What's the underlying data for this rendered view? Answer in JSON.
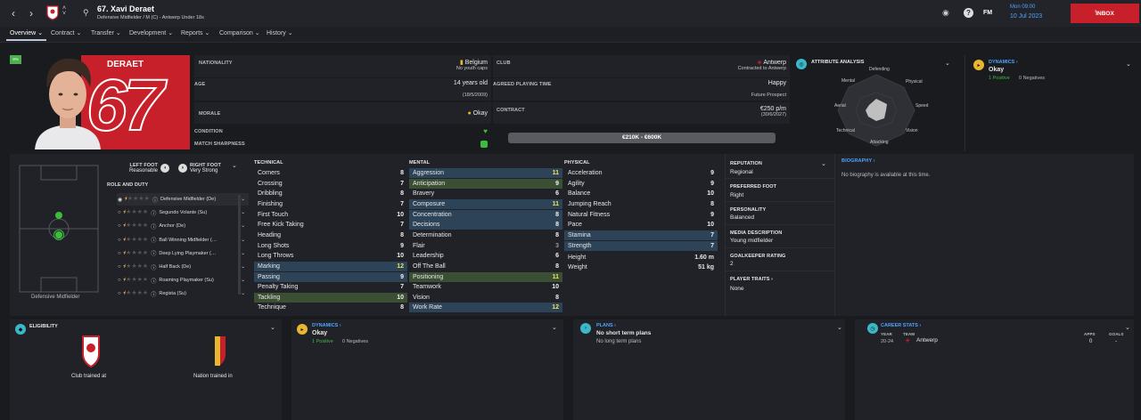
{
  "header": {
    "title": "67. Xavi Deraet",
    "subtitle": "Defensive Midfielder / M (C) - Antwerp Under 18s",
    "date_day": "Mon 09:00",
    "date": "10 Jul 2023",
    "fm_label": "FM",
    "inbox_label": "INBOX"
  },
  "tabs": [
    {
      "label": "Overview"
    },
    {
      "label": "Contract"
    },
    {
      "label": "Transfer"
    },
    {
      "label": "Development"
    },
    {
      "label": "Reports"
    },
    {
      "label": "Comparison"
    },
    {
      "label": "History"
    }
  ],
  "profile": {
    "badge": "9%",
    "surname": "DERAET",
    "number": "67"
  },
  "info": {
    "nationality_label": "NATIONALITY",
    "nationality": "Belgium",
    "youth_caps": "No youth caps",
    "age_label": "AGE",
    "age": "14 years old",
    "dob": "(18/5/2009)",
    "morale_label": "MORALE",
    "morale": "Okay",
    "condition_label": "CONDITION",
    "sharpness_label": "MATCH SHARPNESS",
    "club_label": "CLUB",
    "club": "Antwerp",
    "contracted": "Contracted to Antwerp",
    "playing_time_label": "AGREED PLAYING TIME",
    "playing_time": "Happy",
    "playing_time_sub": "Future Prospect",
    "contract_label": "CONTRACT",
    "wage": "€250 p/m",
    "contract_end": "(30/6/2027)",
    "value": "€210K - €600K"
  },
  "attribute_analysis": {
    "title": "ATTRIBUTE ANALYSIS",
    "axes": [
      "Defending",
      "Physical",
      "Speed",
      "Vision",
      "Attacking",
      "Technical",
      "Aerial",
      "Mental"
    ]
  },
  "dynamics_top": {
    "title": "DYNAMICS",
    "status": "Okay",
    "positives": "1 Positive",
    "negatives": "0 Negatives"
  },
  "feet": {
    "left_label": "LEFT FOOT",
    "left": "Reasonable",
    "right_label": "RIGHT FOOT",
    "right": "Very Strong"
  },
  "pitch_label": "Defensive Midfielder",
  "roles_title": "ROLE AND DUTY",
  "roles": [
    {
      "name": "Defensive Midfielder (De)",
      "stars": 0.5
    },
    {
      "name": "Segundo Volante (Su)",
      "stars": 0.5
    },
    {
      "name": "Anchor (De)",
      "stars": 0.5
    },
    {
      "name": "Ball Winning Midfielder (…",
      "stars": 0.5
    },
    {
      "name": "Deep Lying Playmaker (…",
      "stars": 0.5
    },
    {
      "name": "Half Back (De)",
      "stars": 0.5
    },
    {
      "name": "Roaming Playmaker (Su)",
      "stars": 0.5
    },
    {
      "name": "Regista (Su)",
      "stars": 0.5
    }
  ],
  "technical": {
    "title": "TECHNICAL",
    "rows": [
      {
        "name": "Corners",
        "value": "8"
      },
      {
        "name": "Crossing",
        "value": "7"
      },
      {
        "name": "Dribbling",
        "value": "8"
      },
      {
        "name": "Finishing",
        "value": "7"
      },
      {
        "name": "First Touch",
        "value": "10"
      },
      {
        "name": "Free Kick Taking",
        "value": "7"
      },
      {
        "name": "Heading",
        "value": "8"
      },
      {
        "name": "Long Shots",
        "value": "9"
      },
      {
        "name": "Long Throws",
        "value": "10"
      },
      {
        "name": "Marking",
        "value": "12"
      },
      {
        "name": "Passing",
        "value": "9"
      },
      {
        "name": "Penalty Taking",
        "value": "7"
      },
      {
        "name": "Tackling",
        "value": "10"
      },
      {
        "name": "Technique",
        "value": "8"
      }
    ]
  },
  "mental": {
    "title": "MENTAL",
    "rows": [
      {
        "name": "Aggression",
        "value": "11"
      },
      {
        "name": "Anticipation",
        "value": "9"
      },
      {
        "name": "Bravery",
        "value": "6"
      },
      {
        "name": "Composure",
        "value": "11"
      },
      {
        "name": "Concentration",
        "value": "8"
      },
      {
        "name": "Decisions",
        "value": "8"
      },
      {
        "name": "Determination",
        "value": "8"
      },
      {
        "name": "Flair",
        "value": "3"
      },
      {
        "name": "Leadership",
        "value": "6"
      },
      {
        "name": "Off The Ball",
        "value": "8"
      },
      {
        "name": "Positioning",
        "value": "11"
      },
      {
        "name": "Teamwork",
        "value": "10"
      },
      {
        "name": "Vision",
        "value": "8"
      },
      {
        "name": "Work Rate",
        "value": "12"
      }
    ]
  },
  "physical": {
    "title": "PHYSICAL",
    "rows": [
      {
        "name": "Acceleration",
        "value": "9"
      },
      {
        "name": "Agility",
        "value": "9"
      },
      {
        "name": "Balance",
        "value": "10"
      },
      {
        "name": "Jumping Reach",
        "value": "8"
      },
      {
        "name": "Natural Fitness",
        "value": "9"
      },
      {
        "name": "Pace",
        "value": "10"
      },
      {
        "name": "Stamina",
        "value": "7"
      },
      {
        "name": "Strength",
        "value": "7"
      }
    ],
    "height_label": "Height",
    "height": "1.60 m",
    "weight_label": "Weight",
    "weight": "51 kg"
  },
  "side_info": {
    "reputation_label": "REPUTATION",
    "reputation": "Regional",
    "preferred_foot_label": "PREFERRED FOOT",
    "preferred_foot": "Right",
    "personality_label": "PERSONALITY",
    "personality": "Balanced",
    "media_label": "MEDIA DESCRIPTION",
    "media": "Young midfielder",
    "gk_label": "GOALKEEPER RATING",
    "gk": "2",
    "traits_label": "PLAYER TRAITS",
    "traits": "None"
  },
  "biography": {
    "title": "BIOGRAPHY",
    "text": "No biography is available at this time."
  },
  "eligibility": {
    "title": "ELIGIBILITY",
    "club_label": "Club trained at",
    "nation_label": "Nation trained in"
  },
  "dynamics_bottom": {
    "title": "DYNAMICS",
    "status": "Okay",
    "positives": "1 Positive",
    "negatives": "0 Negatives"
  },
  "plans": {
    "title": "PLANS",
    "short": "No short term plans",
    "long": "No long term plans"
  },
  "career": {
    "title": "CAREER STATS",
    "col_year": "YEAR",
    "col_team": "TEAM",
    "col_apps": "APPS",
    "col_goals": "GOALS",
    "year": "20-24",
    "team": "Antwerp",
    "apps": "0",
    "goals": "-"
  },
  "colors": {
    "accent_red": "#c8202a",
    "highlight_blue": "#2d4358",
    "highlight_green": "#3a4f33",
    "yellow": "#e8b630",
    "green": "#3dbb3d",
    "teal": "#3ab8c8"
  }
}
